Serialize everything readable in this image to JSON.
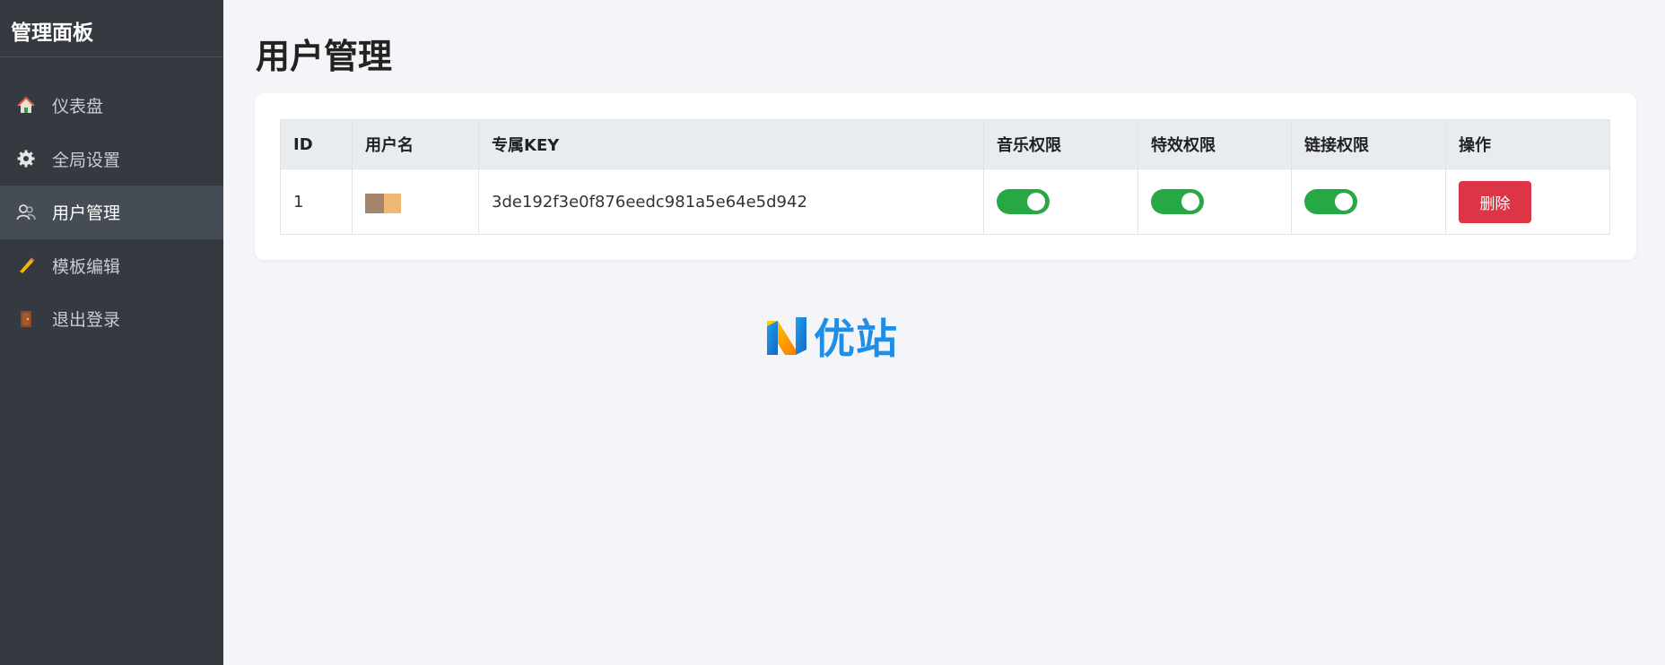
{
  "sidebar": {
    "title": "管理面板",
    "items": [
      {
        "label": "仪表盘",
        "icon": "home-icon"
      },
      {
        "label": "全局设置",
        "icon": "gear-icon"
      },
      {
        "label": "用户管理",
        "icon": "users-icon"
      },
      {
        "label": "模板编辑",
        "icon": "pencil-icon"
      },
      {
        "label": "退出登录",
        "icon": "door-icon"
      }
    ]
  },
  "main": {
    "title": "用户管理",
    "table": {
      "headers": [
        "ID",
        "用户名",
        "专属KEY",
        "音乐权限",
        "特效权限",
        "链接权限",
        "操作"
      ],
      "rows": [
        {
          "id": "1",
          "key": "3de192f3e0f876eedc981a5e64e5d942",
          "music": true,
          "effects": true,
          "links": true,
          "action": "删除"
        }
      ]
    }
  },
  "watermark": {
    "text": "优站"
  },
  "colors": {
    "sidebar_bg": "#343a40",
    "toggle_on": "#28a745",
    "delete_btn": "#dc3545",
    "watermark": "#1e8ee6"
  }
}
